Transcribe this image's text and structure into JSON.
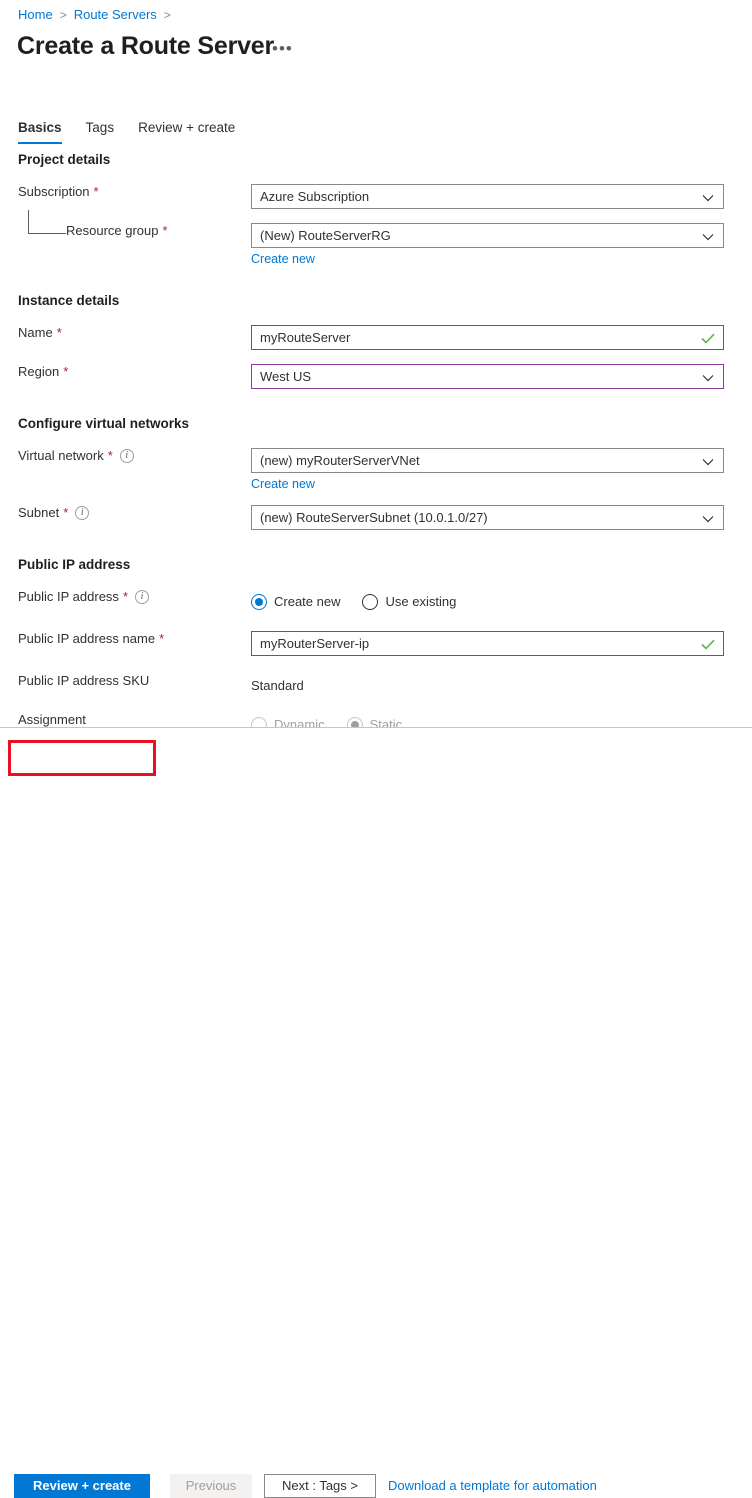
{
  "breadcrumb": {
    "items": [
      {
        "label": "Home"
      },
      {
        "label": "Route Servers"
      }
    ],
    "separator": ">"
  },
  "header": {
    "title": "Create a Route Server",
    "more_label": "•••"
  },
  "tabs": [
    {
      "label": "Basics",
      "active": true
    },
    {
      "label": "Tags",
      "active": false
    },
    {
      "label": "Review + create",
      "active": false
    }
  ],
  "sections": {
    "project_details": {
      "heading": "Project details",
      "subscription": {
        "label": "Subscription",
        "required": "*",
        "value": "Azure Subscription"
      },
      "resource_group": {
        "label": "Resource group",
        "required": "*",
        "value": "(New) RouteServerRG",
        "create_new_label": "Create new"
      }
    },
    "instance_details": {
      "heading": "Instance details",
      "name": {
        "label": "Name",
        "required": "*",
        "value": "myRouteServer"
      },
      "region": {
        "label": "Region",
        "required": "*",
        "value": "West US"
      }
    },
    "virtual_networks": {
      "heading": "Configure virtual networks",
      "virtual_network": {
        "label": "Virtual network",
        "required": "*",
        "value": "(new) myRouterServerVNet",
        "create_new_label": "Create new"
      },
      "subnet": {
        "label": "Subnet",
        "required": "*",
        "value": "(new) RouteServerSubnet (10.0.1.0/27)"
      }
    },
    "public_ip": {
      "heading": "Public IP address",
      "public_ip_address": {
        "label": "Public IP address",
        "required": "*",
        "options": [
          {
            "label": "Create new",
            "selected": true
          },
          {
            "label": "Use existing",
            "selected": false
          }
        ]
      },
      "public_ip_name": {
        "label": "Public IP address name",
        "required": "*",
        "value": "myRouterServer-ip"
      },
      "public_ip_sku": {
        "label": "Public IP address SKU",
        "value": "Standard"
      },
      "assignment": {
        "label": "Assignment",
        "options": [
          {
            "label": "Dynamic",
            "selected": false
          },
          {
            "label": "Static",
            "selected": true
          }
        ]
      }
    }
  },
  "footer": {
    "review_create_label": "Review + create",
    "previous_label": "Previous",
    "next_label": "Next : Tags >",
    "download_template_label": "Download a template for automation"
  },
  "icons": {
    "info": "i",
    "chevron_down": "chevron-down-icon",
    "validation_check": "check-icon"
  },
  "colors": {
    "accent": "#0078d4",
    "required": "#a4262c",
    "valid_border": "#8e3a9e",
    "valid_check": "#5ab54a",
    "highlight": "#e81123"
  }
}
